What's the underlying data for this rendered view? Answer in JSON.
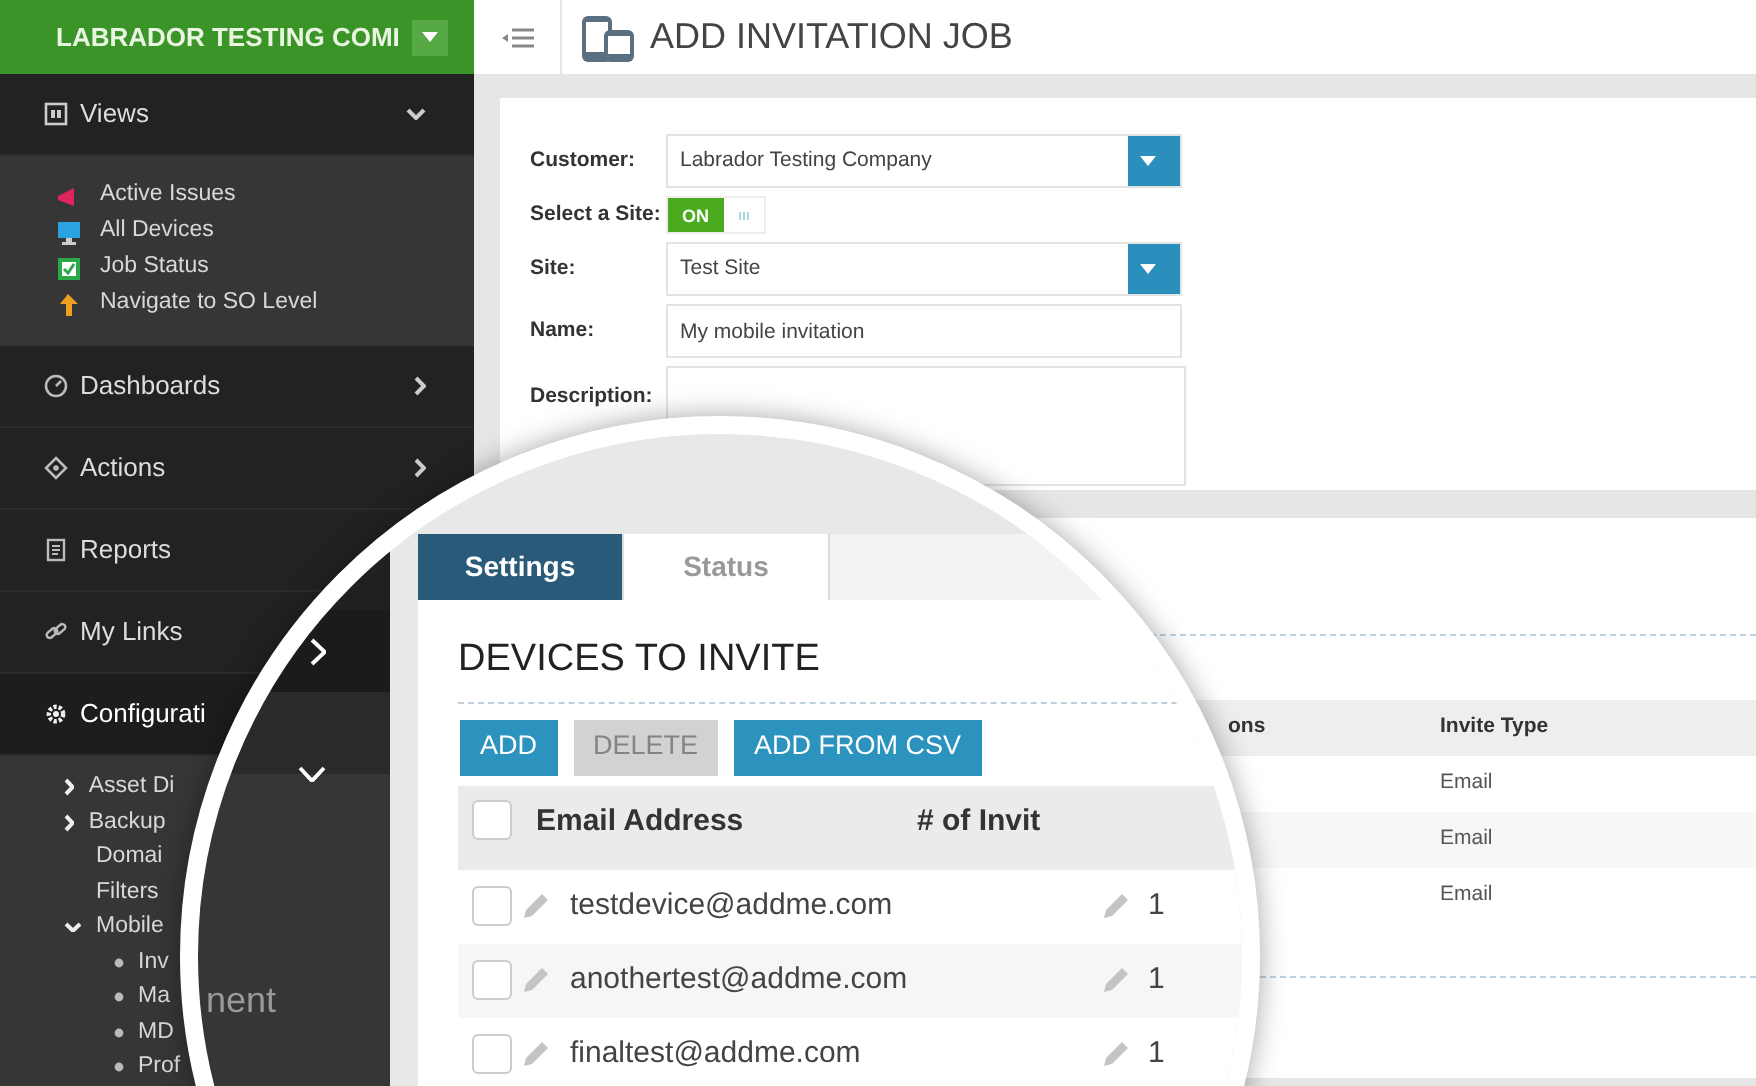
{
  "sidebar": {
    "org_name": "LABRADOR TESTING COMI",
    "sections": [
      {
        "label": "Views",
        "expanded": true,
        "children": [
          {
            "label": "Active Issues"
          },
          {
            "label": "All Devices"
          },
          {
            "label": "Job Status"
          },
          {
            "label": "Navigate to SO Level"
          }
        ]
      },
      {
        "label": "Dashboards",
        "expanded": false
      },
      {
        "label": "Actions",
        "expanded": false
      },
      {
        "label": "Reports"
      },
      {
        "label": "My Links"
      },
      {
        "label": "Configurati",
        "children": [
          {
            "label": "Asset Di",
            "expanded": false
          },
          {
            "label": "Backup",
            "expanded": false
          },
          {
            "label": "Domai"
          },
          {
            "label": "Filters"
          },
          {
            "label": "Mobile",
            "expanded": true,
            "children": [
              {
                "label": "Inv"
              },
              {
                "label": "Ma"
              },
              {
                "label": "MD"
              },
              {
                "label": "Prof"
              }
            ]
          }
        ]
      }
    ]
  },
  "header": {
    "title": "ADD INVITATION JOB"
  },
  "form": {
    "fields": [
      {
        "kind": "select",
        "label": "Customer:",
        "value": "Labrador Testing Company"
      },
      {
        "kind": "toggle",
        "label": "Select a Site:",
        "on": true,
        "on_label": "ON"
      },
      {
        "kind": "select",
        "label": "Site:",
        "value": "Test Site"
      },
      {
        "kind": "text",
        "label": "Name:",
        "value": "My mobile invitation"
      },
      {
        "kind": "textarea",
        "label": "Description:"
      }
    ]
  },
  "invite_table": {
    "columns": [
      "ons",
      "Invite Type"
    ],
    "rows": [
      {
        "invite_type": "Email"
      },
      {
        "invite_type": "Email"
      },
      {
        "invite_type": "Email"
      }
    ]
  },
  "magnifier": {
    "sidebar_rows": [
      {
        "expanded": false
      },
      {
        "expanded": true
      }
    ],
    "sidebar_fragment": "nent",
    "tabs": [
      {
        "label": "Settings",
        "selected": true
      },
      {
        "label": "Status",
        "selected": false
      }
    ],
    "heading": "DEVICES TO INVITE",
    "buttons": [
      {
        "label": "ADD",
        "disabled": false
      },
      {
        "label": "DELETE",
        "disabled": true
      },
      {
        "label": "ADD FROM CSV",
        "disabled": false
      }
    ],
    "select_all_checked": false,
    "columns": [
      "Email Address",
      "# of Invit"
    ],
    "rows": [
      {
        "email": "testdevice@addme.com",
        "count": "1",
        "checked": false
      },
      {
        "email": "anothertest@addme.com",
        "count": "1",
        "checked": false
      },
      {
        "email": "finaltest@addme.com",
        "count": "1",
        "checked": false
      }
    ]
  }
}
